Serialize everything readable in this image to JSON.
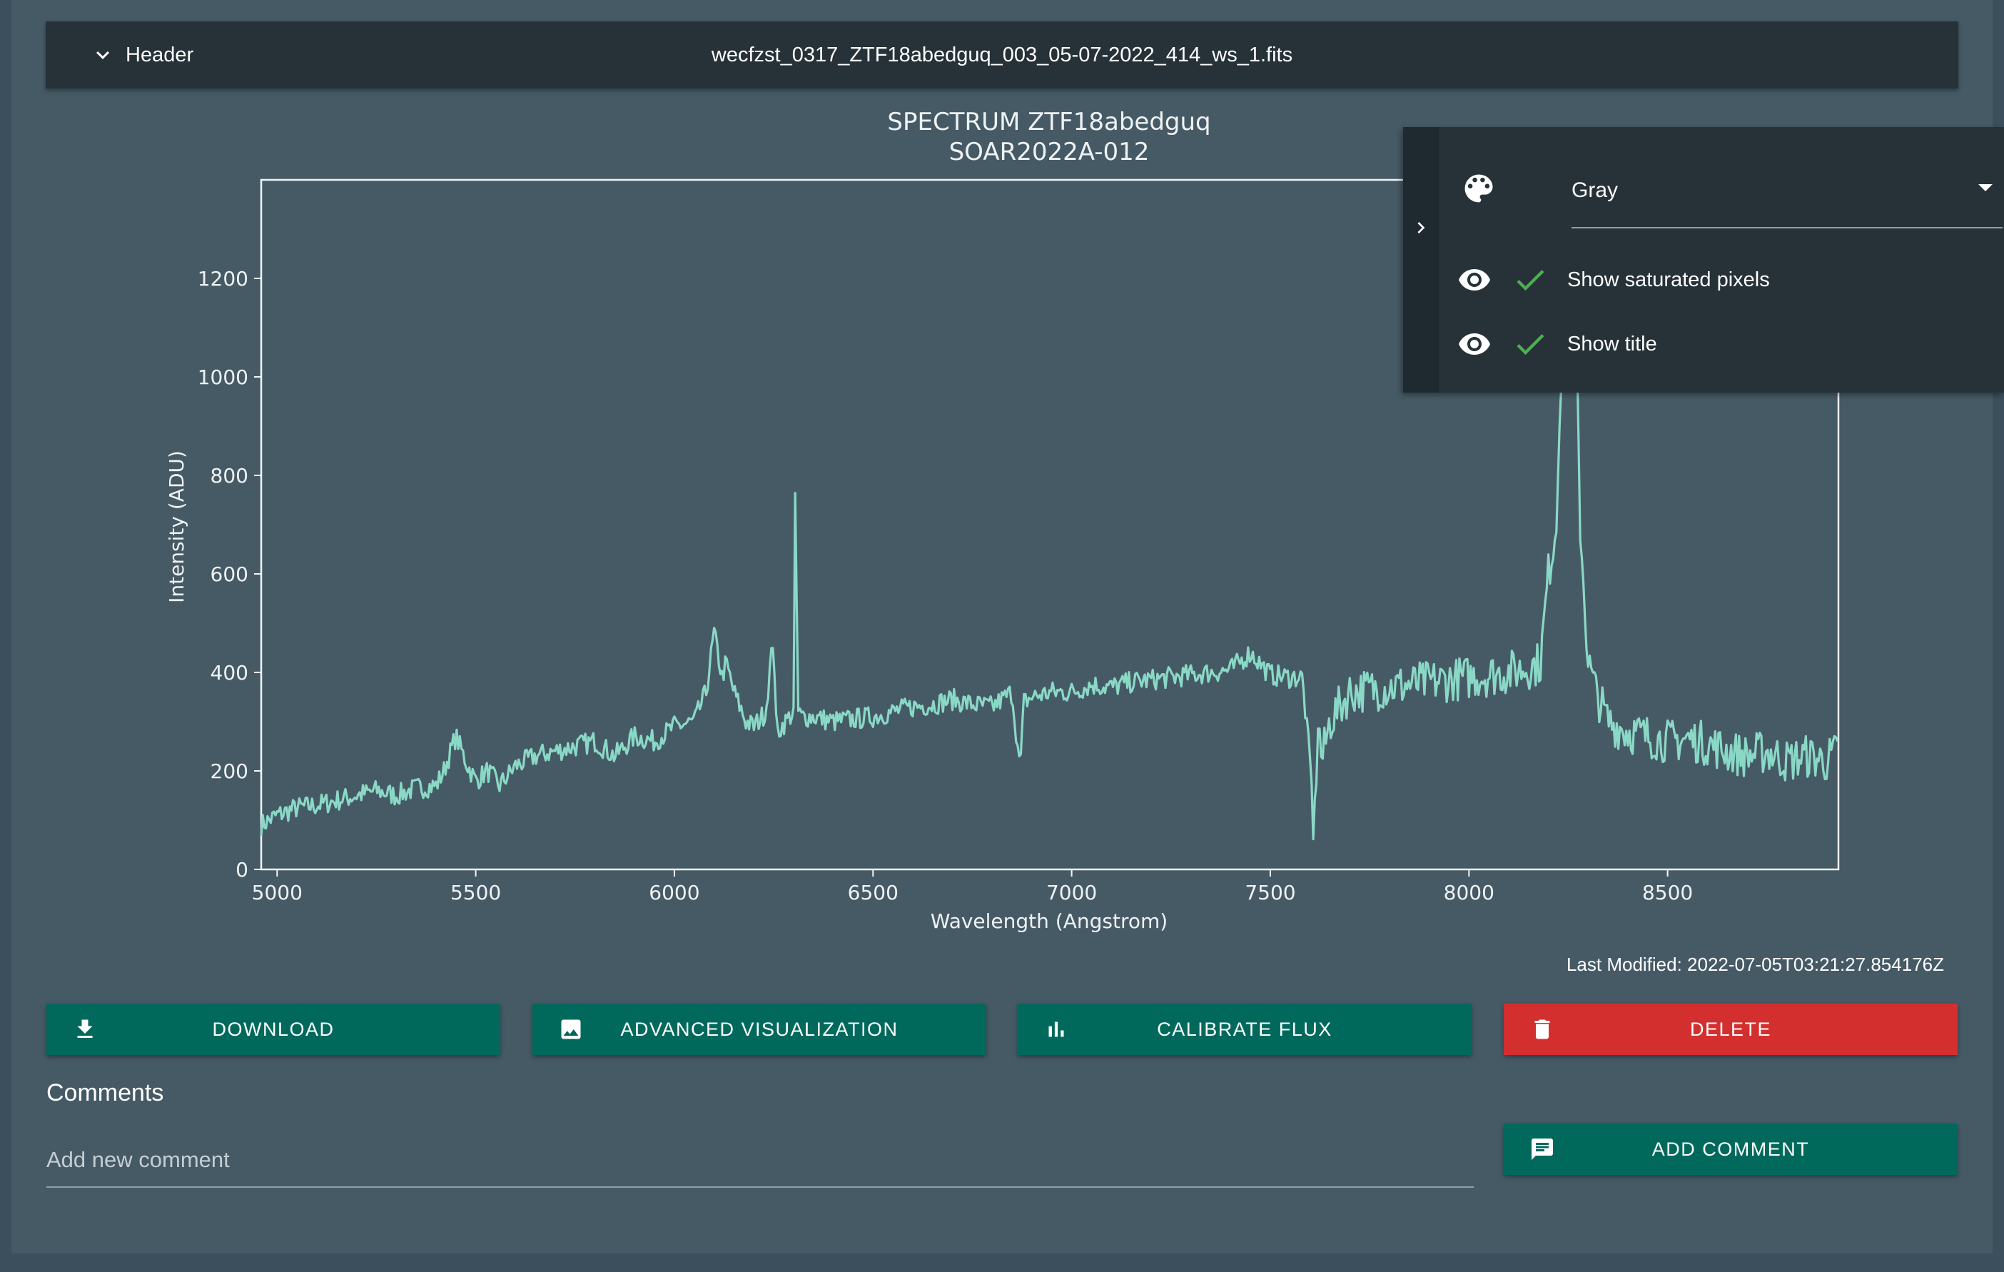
{
  "header": {
    "toggle_label": "Header",
    "filename": "wecfzst_0317_ZTF18abedguq_003_05-07-2022_414_ws_1.fits"
  },
  "settings_panel": {
    "colormap": "Gray",
    "options": [
      {
        "label": "Show saturated pixels",
        "checked": true
      },
      {
        "label": "Show title",
        "checked": true
      }
    ]
  },
  "last_modified": "Last Modified: 2022-07-05T03:21:27.854176Z",
  "buttons": {
    "download": "DOWNLOAD",
    "advanced": "ADVANCED VISUALIZATION",
    "calibrate": "CALIBRATE FLUX",
    "delete": "DELETE",
    "add_comment": "ADD COMMENT"
  },
  "comments": {
    "title": "Comments",
    "placeholder": "Add new comment"
  },
  "colors": {
    "line": "#8ad8c6",
    "primary_button": "#00695c",
    "danger_button": "#d32f2f",
    "check": "#4caf50"
  },
  "chart_data": {
    "type": "line",
    "title": "SPECTRUM ZTF18abedguq",
    "subtitle": "SOAR2022A-012",
    "xlabel": "Wavelength (Angstrom)",
    "ylabel": "Intensity (ADU)",
    "xlim": [
      4960,
      8930
    ],
    "ylim": [
      0,
      1400
    ],
    "xticks": [
      5000,
      5500,
      6000,
      6500,
      7000,
      7500,
      8000,
      8500
    ],
    "yticks": [
      0,
      200,
      400,
      600,
      800,
      1000,
      1200
    ],
    "grid": false,
    "series": [
      {
        "x": [
          4960,
          5000,
          5050,
          5100,
          5150,
          5200,
          5250,
          5300,
          5350,
          5400,
          5420,
          5450,
          5480,
          5500,
          5530,
          5560,
          5600,
          5650,
          5700,
          5750,
          5800,
          5850,
          5900,
          5950,
          6000,
          6050,
          6080,
          6100,
          6120,
          6130,
          6150,
          6180,
          6200,
          6230,
          6250,
          6255,
          6260,
          6280,
          6300,
          6305,
          6310,
          6320,
          6350,
          6400,
          6450,
          6500,
          6550,
          6600,
          6650,
          6700,
          6750,
          6800,
          6850,
          6870,
          6880,
          6900,
          6950,
          7000,
          7050,
          7100,
          7150,
          7200,
          7250,
          7300,
          7350,
          7400,
          7450,
          7500,
          7550,
          7580,
          7600,
          7610,
          7620,
          7630,
          7650,
          7700,
          7750,
          7800,
          7850,
          7900,
          7950,
          8000,
          8050,
          8100,
          8150,
          8180,
          8200,
          8220,
          8230,
          8250,
          8260,
          8270,
          8280,
          8300,
          8320,
          8350,
          8400,
          8450,
          8500,
          8550,
          8600,
          8650,
          8700,
          8750,
          8800,
          8850,
          8900,
          8930
        ],
        "y": [
          90,
          110,
          125,
          130,
          140,
          150,
          160,
          150,
          165,
          170,
          200,
          270,
          210,
          180,
          200,
          170,
          210,
          230,
          240,
          250,
          260,
          230,
          270,
          260,
          290,
          300,
          360,
          480,
          390,
          420,
          360,
          300,
          290,
          320,
          480,
          300,
          280,
          300,
          320,
          850,
          320,
          310,
          310,
          300,
          305,
          310,
          320,
          330,
          335,
          345,
          335,
          330,
          360,
          200,
          340,
          350,
          360,
          360,
          375,
          370,
          380,
          385,
          390,
          395,
          400,
          405,
          440,
          395,
          390,
          390,
          220,
          60,
          300,
          220,
          300,
          360,
          365,
          370,
          375,
          380,
          385,
          390,
          395,
          400,
          410,
          420,
          600,
          700,
          1000,
          1050,
          1100,
          1080,
          700,
          420,
          360,
          300,
          280,
          270,
          260,
          265,
          255,
          240,
          230,
          240,
          220,
          230,
          220,
          240
        ]
      }
    ]
  }
}
